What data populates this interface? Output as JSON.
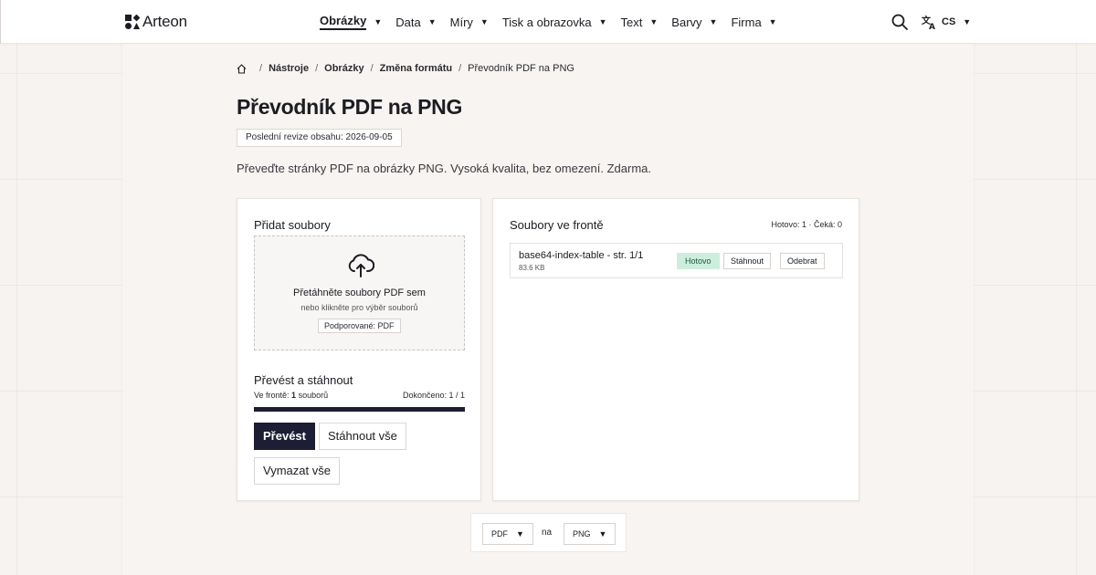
{
  "brand": {
    "name": "Arteon"
  },
  "nav": {
    "items": [
      {
        "label": "Obrázky",
        "active": true
      },
      {
        "label": "Data",
        "active": false
      },
      {
        "label": "Míry",
        "active": false
      },
      {
        "label": "Tisk a obrazovka",
        "active": false
      },
      {
        "label": "Text",
        "active": false
      },
      {
        "label": "Barvy",
        "active": false
      },
      {
        "label": "Firma",
        "active": false
      }
    ],
    "language": "CS",
    "icons": {
      "search": "search-icon",
      "language": "translate-icon",
      "dropdown": "caret-down-icon"
    }
  },
  "breadcrumb": {
    "home_icon": "home-icon",
    "items": [
      "Nástroje",
      "Obrázky",
      "Změna formátu"
    ],
    "current": "Převodník PDF na PNG"
  },
  "page": {
    "title": "Převodník PDF na PNG",
    "revision": "Poslední revize obsahu: 2026-09-05",
    "lead": "Převeďte stránky PDF na obrázky PNG. Vysoká kvalita, bez omezení. Zdarma."
  },
  "upload": {
    "heading": "Přidat soubory",
    "icon": "cloud-upload-icon",
    "dropzone_title": "Přetáhněte soubory PDF sem",
    "dropzone_subtitle": "nebo klikněte pro výběr souborů",
    "supported": "Podporované: PDF"
  },
  "convert": {
    "heading": "Převést a stáhnout",
    "queue_label": "Ve frontě:",
    "queue_count": "1",
    "queue_unit": "souborů",
    "done_label": "Dokončeno: 1 / 1",
    "progress": 1.0,
    "convert_button": "Převést",
    "download_all_button": "Stáhnout vše",
    "clear_all_button": "Vymazat vše"
  },
  "queue": {
    "heading": "Soubory ve frontě",
    "stats": "Hotovo: 1 · Čeká: 0",
    "files": [
      {
        "name": "base64-index-table - str. 1/1",
        "size": "83.6 KB",
        "status": "Hotovo",
        "download_label": "Stáhnout",
        "remove_label": "Odebrat"
      }
    ]
  },
  "formats": {
    "from": "PDF",
    "to_word": "na",
    "to": "PNG"
  },
  "colors": {
    "primary": "#1d1e33",
    "success_bg": "#cdeedd",
    "page_bg": "#f7f3f0"
  }
}
